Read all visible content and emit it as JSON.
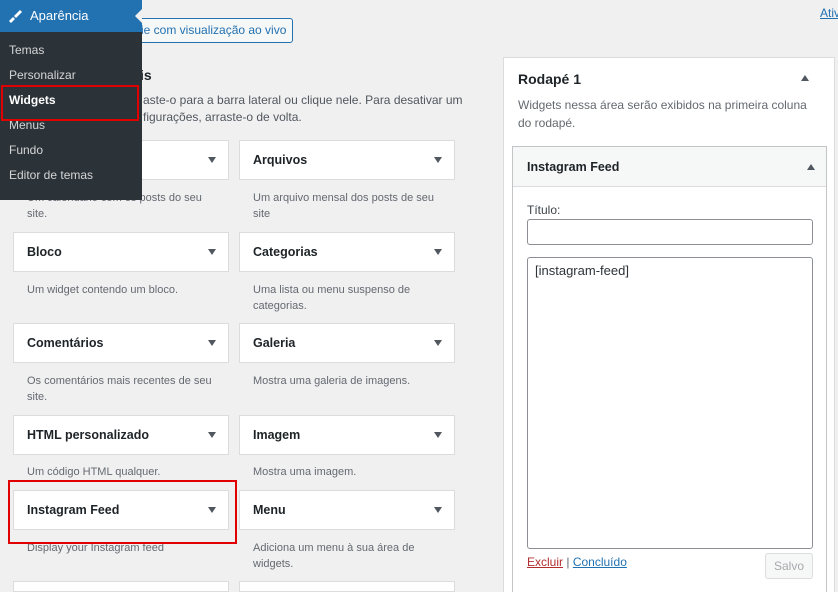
{
  "top_link": "Ativ",
  "live_preview_button": "ie com visualização ao vivo",
  "available_widgets": {
    "heading": "is",
    "description_line1": "aste-o para a barra lateral ou clique nele. Para desativar um",
    "description_line2": "figurações, arraste-o de volta."
  },
  "admin_menu": {
    "parent": "Aparência",
    "items": [
      "Temas",
      "Personalizar",
      "Widgets",
      "Menus",
      "Fundo",
      "Editor de temas"
    ],
    "current": "Widgets"
  },
  "widgets": [
    {
      "title": "",
      "desc1": "Um calendário com os posts do seu",
      "desc2": "site."
    },
    {
      "title": "Arquivos",
      "desc1": "Um arquivo mensal dos posts de seu",
      "desc2": "site"
    },
    {
      "title": "Bloco",
      "desc1": "Um widget contendo um bloco.",
      "desc2": ""
    },
    {
      "title": "Categorias",
      "desc1": "Uma lista ou menu suspenso de",
      "desc2": "categorias."
    },
    {
      "title": "Comentários",
      "desc1": "Os comentários mais recentes de seu",
      "desc2": "site."
    },
    {
      "title": "Galeria",
      "desc1": "Mostra uma galeria de imagens.",
      "desc2": ""
    },
    {
      "title": "HTML personalizado",
      "desc1": "Um código HTML qualquer.",
      "desc2": ""
    },
    {
      "title": "Imagem",
      "desc1": "Mostra uma imagem.",
      "desc2": ""
    },
    {
      "title": "Instagram Feed",
      "desc1": "Display your Instagram feed",
      "desc2": ""
    },
    {
      "title": "Menu",
      "desc1": "Adiciona um menu à sua área de",
      "desc2": "widgets."
    }
  ],
  "sidebar": {
    "title": "Rodapé 1",
    "description": "Widgets nessa área serão exibidos na primeira coluna do rodapé.",
    "widget": {
      "name": "Instagram Feed",
      "title_label": "Título:",
      "title_value": "",
      "content": "[instagram-feed]",
      "delete_label": "Excluir",
      "separator": "|",
      "done_label": "Concluído",
      "save_label": "Salvo"
    }
  },
  "colors": {
    "accent": "#2271b1",
    "menu_bg": "#2c3338",
    "highlight": "#e00000"
  }
}
